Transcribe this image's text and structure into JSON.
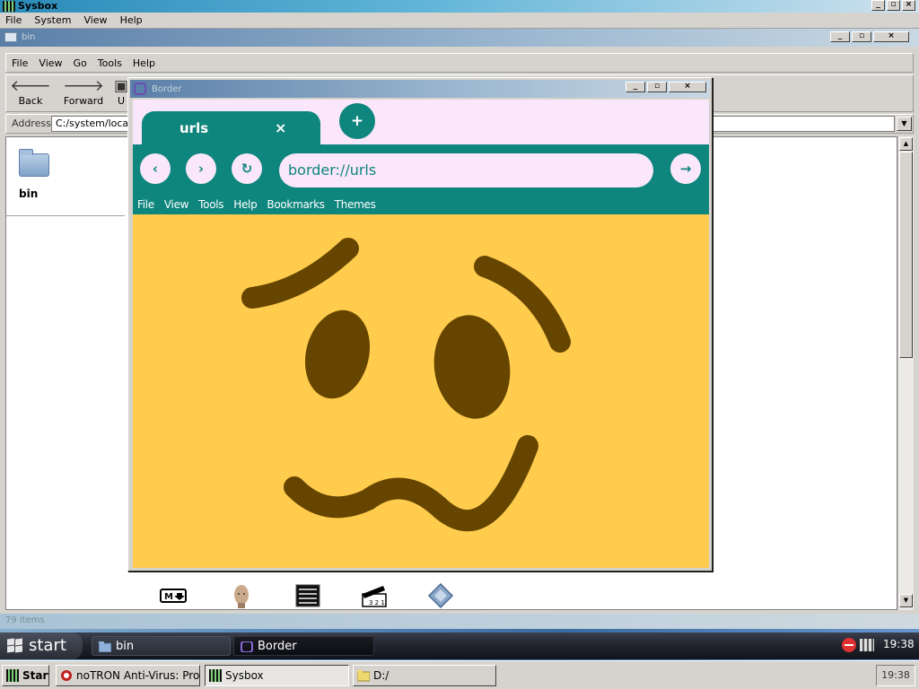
{
  "sysbox": {
    "title": "Sysbox",
    "menu": [
      "File",
      "System",
      "View",
      "Help"
    ],
    "controls": {
      "minimize": "_",
      "restore": "▫",
      "close": "×"
    }
  },
  "file_manager": {
    "title": "bin",
    "menu": [
      "File",
      "View",
      "Go",
      "Tools",
      "Help"
    ],
    "toolbar": {
      "back_label": "Back",
      "forward_label": "Forward",
      "up_label": "U"
    },
    "address_label": "Address",
    "address_value": "C:/system/local/bin",
    "left_folder_label": "bin",
    "status": "79 items",
    "file_icons": [
      "markdown-icon",
      "face-icon",
      "binary-file-icon",
      "clapper-icon",
      "diamond-icon"
    ],
    "controls": {
      "minimize": "_",
      "restore": "▫",
      "close": "×"
    }
  },
  "browser": {
    "window_title": "Border",
    "tab": {
      "label": "urls",
      "close": "×"
    },
    "new_tab": "+",
    "nav": {
      "back": "‹",
      "forward": "›",
      "reload": "↻",
      "go": "→"
    },
    "url": "border://urls",
    "menu": [
      "File",
      "View",
      "Tools",
      "Help",
      "Bookmarks",
      "Themes"
    ],
    "page_emoji": "woozy-face",
    "colors": {
      "accent": "#0e857d",
      "tab_strip": "#fbe7fb",
      "page_bg": "#ffcc4d",
      "feature": "#664500"
    },
    "controls": {
      "minimize": "_",
      "restore": "▫",
      "close": "×"
    }
  },
  "xp_taskbar": {
    "start_label": "start",
    "tasks": [
      {
        "label": "bin",
        "icon": "folder-icon"
      },
      {
        "label": "Border",
        "icon": "border-app-icon"
      }
    ],
    "clock": "19:38"
  },
  "classic_taskbar": {
    "start_label": "Start",
    "tasks": [
      {
        "label": "noTRON Anti-Virus: Profes...",
        "icon": "antivirus-icon"
      },
      {
        "label": "Sysbox",
        "icon": "sysbox-icon"
      },
      {
        "label": "D:/",
        "icon": "folder-icon"
      }
    ],
    "clock": "19:38"
  }
}
